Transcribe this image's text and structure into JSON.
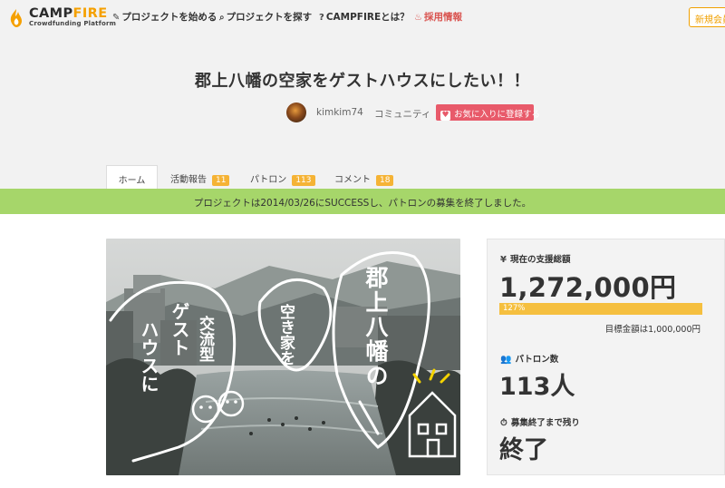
{
  "brand": {
    "name_a": "CAMP",
    "name_b": "FIRE",
    "tagline": "Crowdfunding Platform"
  },
  "nav": {
    "start": "プロジェクトを始める",
    "explore": "プロジェクトを探す",
    "about": "CAMPFIREとは？",
    "hiring": "採用情報",
    "signup": "新規会員"
  },
  "project": {
    "title": "郡上八幡の空家をゲストハウスにしたい！！",
    "owner": "kimkim74",
    "category": "コミュニティ",
    "favorite_label": "お気に入りに登録する"
  },
  "tabs": [
    {
      "label": "ホーム",
      "count": ""
    },
    {
      "label": "活動報告",
      "count": "11"
    },
    {
      "label": "パトロン",
      "count": "113"
    },
    {
      "label": "コメント",
      "count": "18"
    }
  ],
  "banner": {
    "text": "プロジェクトは2014/03/26にSUCCESSし、パトロンの募集を終了しました。"
  },
  "hero_image": {
    "text_vertical_1": "郡上八幡の",
    "text_vertical_2": "空き家を",
    "text_vertical_3": "交流型",
    "text_vertical_4": "ゲスト",
    "text_vertical_5": "ハウスに"
  },
  "funding": {
    "total_label": "現在の支援総額",
    "total_amount": "1,272,000円",
    "percent_text": "127%",
    "percent_value": 1.27,
    "goal_text": "目標金額は1,000,000円",
    "patron_label": "パトロン数",
    "patron_count": "113人",
    "remaining_label": "募集終了まで残り",
    "remaining_value": "終了"
  },
  "colors": {
    "brand_orange": "#f5a000",
    "success_green": "#a6d66a",
    "progress_yellow": "#f5bf3f",
    "favorite_pink": "#e85a6a",
    "badge_yellow": "#f5b335"
  }
}
